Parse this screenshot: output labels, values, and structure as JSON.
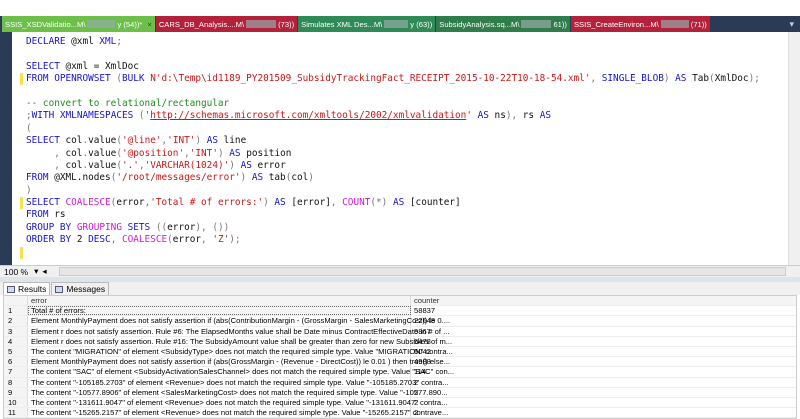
{
  "tabs": [
    {
      "label": "SSIS_XSDValidatio...M\\",
      "suffix": "y (54))*",
      "color": "#6cc04a",
      "active": true,
      "close": "×"
    },
    {
      "label": "CARS_DB_Analysis....M\\",
      "suffix": "(73))",
      "color": "#b3213a"
    },
    {
      "label": "Simulates XML Des...M\\",
      "suffix": "y (63))",
      "color": "#2e8b57"
    },
    {
      "label": "SubsidyAnalysis.sq...M\\",
      "suffix": "61))",
      "color": "#2f7d4a"
    },
    {
      "label": "SSIS_CreateEnviron...M\\",
      "suffix": "(71))",
      "color": "#b3213a"
    }
  ],
  "tab_menu_icon": "dropdown-arrow-icon",
  "code": [
    [
      [
        "DECLARE ",
        "kw"
      ],
      [
        "@xml ",
        "tx"
      ],
      [
        "XML",
        "kw"
      ],
      [
        ";",
        "gr"
      ]
    ],
    [],
    [
      [
        "SELECT ",
        "kw"
      ],
      [
        "@xml = XmlDoc",
        "tx"
      ]
    ],
    [
      [
        "FROM ",
        "kw"
      ],
      [
        "OPENROWSET ",
        "kw"
      ],
      [
        "(",
        "gr"
      ],
      [
        "BULK ",
        "kw"
      ],
      [
        "N'd:\\Temp\\id1189_PY201509_SubsidyTrackingFact_RECEIPT_2015-10-22T10-18-54.xml'",
        "str"
      ],
      [
        ", ",
        "gr"
      ],
      [
        "SINGLE_BLOB",
        "kw"
      ],
      [
        ") ",
        "gr"
      ],
      [
        "AS ",
        "kw"
      ],
      [
        "Tab",
        "tx"
      ],
      [
        "(",
        "gr"
      ],
      [
        "XmlDoc",
        "tx"
      ],
      [
        ");",
        "gr"
      ]
    ],
    [],
    [
      [
        "-- convert to relational/rectangular",
        "cm"
      ]
    ],
    [
      [
        ";",
        "gr"
      ],
      [
        "WITH ",
        "kw"
      ],
      [
        "XMLNAMESPACES ",
        "kw"
      ],
      [
        "(",
        "gr"
      ],
      [
        "'",
        "str"
      ],
      [
        "http://schemas.microsoft.com/xmltools/2002/xmlvalidation",
        "url"
      ],
      [
        "'",
        "str"
      ],
      [
        " AS ",
        "kw"
      ],
      [
        "ns",
        "tx"
      ],
      [
        "), ",
        "gr"
      ],
      [
        "rs ",
        "tx"
      ],
      [
        "AS",
        "kw"
      ]
    ],
    [
      [
        "(",
        "gr"
      ]
    ],
    [
      [
        "SELECT ",
        "kw"
      ],
      [
        "col",
        "tx"
      ],
      [
        ".",
        "gr"
      ],
      [
        "value",
        "tx"
      ],
      [
        "(",
        "gr"
      ],
      [
        "'@line'",
        "str"
      ],
      [
        ",",
        "gr"
      ],
      [
        "'INT'",
        "str"
      ],
      [
        ") ",
        "gr"
      ],
      [
        "AS ",
        "kw"
      ],
      [
        "line",
        "tx"
      ]
    ],
    [
      [
        "     , ",
        "gr"
      ],
      [
        "col",
        "tx"
      ],
      [
        ".",
        "gr"
      ],
      [
        "value",
        "tx"
      ],
      [
        "(",
        "gr"
      ],
      [
        "'@position'",
        "str"
      ],
      [
        ",",
        "gr"
      ],
      [
        "'INT'",
        "str"
      ],
      [
        ") ",
        "gr"
      ],
      [
        "AS ",
        "kw"
      ],
      [
        "position",
        "tx"
      ]
    ],
    [
      [
        "     , ",
        "gr"
      ],
      [
        "col",
        "tx"
      ],
      [
        ".",
        "gr"
      ],
      [
        "value",
        "tx"
      ],
      [
        "(",
        "gr"
      ],
      [
        "'.'",
        "str"
      ],
      [
        ",",
        "gr"
      ],
      [
        "'VARCHAR(1024)'",
        "str"
      ],
      [
        ") ",
        "gr"
      ],
      [
        "AS ",
        "kw"
      ],
      [
        "error",
        "tx"
      ]
    ],
    [
      [
        "FROM ",
        "kw"
      ],
      [
        "@XML.nodes",
        "tx"
      ],
      [
        "(",
        "gr"
      ],
      [
        "'/root/messages/error'",
        "str"
      ],
      [
        ") ",
        "gr"
      ],
      [
        "AS ",
        "kw"
      ],
      [
        "tab",
        "tx"
      ],
      [
        "(",
        "gr"
      ],
      [
        "col",
        "tx"
      ],
      [
        ")",
        "gr"
      ]
    ],
    [
      [
        ")",
        "gr"
      ]
    ],
    [
      [
        "SELECT ",
        "kw"
      ],
      [
        "COALESCE",
        "fn"
      ],
      [
        "(",
        "gr"
      ],
      [
        "error",
        "tx"
      ],
      [
        ",",
        "gr"
      ],
      [
        "'Total # of errors:'",
        "str"
      ],
      [
        ") ",
        "gr"
      ],
      [
        "AS ",
        "kw"
      ],
      [
        "[error]",
        "tx"
      ],
      [
        ", ",
        "gr"
      ],
      [
        "COUNT",
        "fn"
      ],
      [
        "(*) ",
        "gr"
      ],
      [
        "AS ",
        "kw"
      ],
      [
        "[counter]",
        "tx"
      ]
    ],
    [
      [
        "FROM ",
        "kw"
      ],
      [
        "rs",
        "tx"
      ]
    ],
    [
      [
        "GROUP BY ",
        "kw"
      ],
      [
        "GROUPING ",
        "fn"
      ],
      [
        "SETS ",
        "kw"
      ],
      [
        "((",
        "gr"
      ],
      [
        "error",
        "tx"
      ],
      [
        "), ())",
        "gr"
      ]
    ],
    [
      [
        "ORDER BY ",
        "kw"
      ],
      [
        "2 ",
        "tx"
      ],
      [
        "DESC",
        "kw"
      ],
      [
        ", ",
        "gr"
      ],
      [
        "COALESCE",
        "fn"
      ],
      [
        "(",
        "gr"
      ],
      [
        "error",
        "tx"
      ],
      [
        ", ",
        "gr"
      ],
      [
        "'Z'",
        "str"
      ],
      [
        ");",
        "gr"
      ]
    ],
    []
  ],
  "changed_lines": [
    3,
    13,
    17
  ],
  "zoom": "100 %",
  "results_tabs": [
    "Results",
    "Messages"
  ],
  "grid": {
    "columns": [
      "error",
      "counter"
    ],
    "rows": [
      [
        "1",
        "Total # of errors:",
        "58837"
      ],
      [
        "2",
        "Element MonthlyPayment does not satisfy assertion if (abs(ContributionMargin - (GrossMargin - SalesMarketingCost)) le 0....",
        "22648"
      ],
      [
        "3",
        "Element r does not satisfy assertion. Rule #6: The ElapsedMonths value shall be Date minus ContractEffectiveDate in # of ...",
        "9867"
      ],
      [
        "4",
        "Element r does not satisfy assertion. Rule #16: The SubsidyAmount value shall be greater than zero for new Subsidies of m...",
        "5478"
      ],
      [
        "5",
        "The content \"MIGRATION\" of element <SubsidyType> does not match the required simple type. Value \"MIGRATION\" contra...",
        "5042"
      ],
      [
        "6",
        "Element MonthlyPayment does not satisfy assertion if (abs(GrossMargin - (Revenue - DirectCost)) le 0.01 ) then true() else...",
        "4988"
      ],
      [
        "7",
        "The content \"SAC\" of element <SubsidyActivationSalesChannel> does not match the required simple type. Value \"SAC\" con...",
        "114"
      ],
      [
        "8",
        "The content \"-105185.2703\" of element <Revenue> does not match the required simple type. Value \"-105185.2703\" contra...",
        "2"
      ],
      [
        "9",
        "The content \"-10577.8906\" of element <SalesMarketingCost> does not match the required simple type. Value \"-10577.890...",
        "2"
      ],
      [
        "10",
        "The content \"-131611.9047\" of element <Revenue> does not match the required simple type. Value \"-131611.9047\" contra...",
        "2"
      ],
      [
        "11",
        "The content \"-15265.2157\" of element <Revenue> does not match the required simple type. Value \"-15265.2157\" contrave...",
        "2"
      ]
    ]
  }
}
